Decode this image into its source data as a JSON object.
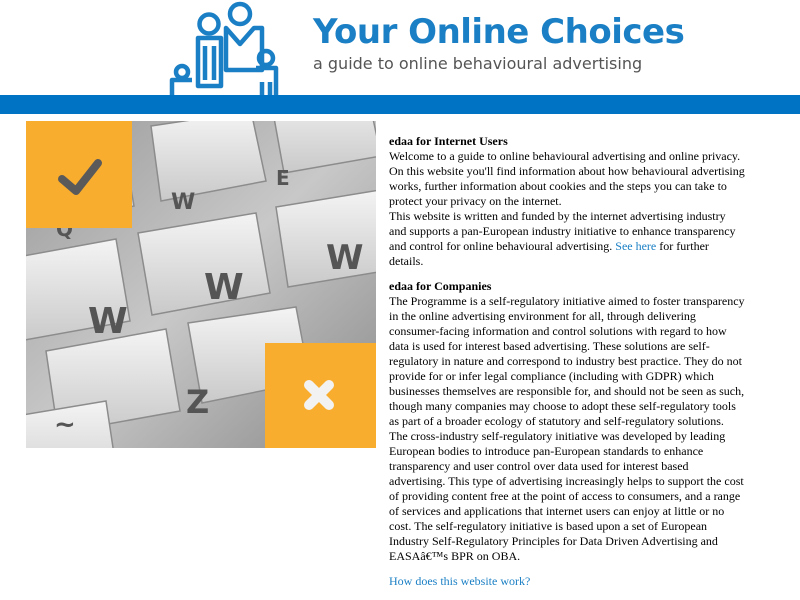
{
  "header": {
    "brand_title": "Your Online Choices",
    "brand_subtitle": "a guide to online behavioural advertising",
    "logo_icon": "family-icon"
  },
  "colors": {
    "brand_blue": "#1a7fc4",
    "bar_blue": "#0073c4",
    "accent_orange": "#f9ad2f",
    "link": "#1a7fc4"
  },
  "hero": {
    "tile_icons": [
      "checkmark-icon",
      "cross-icon"
    ],
    "key_letters": [
      "W",
      "E",
      "W",
      "W",
      "Q",
      "W",
      "W",
      "Z",
      "~"
    ]
  },
  "users": {
    "heading": "edaa for Internet Users",
    "para1": "Welcome to a guide to online behavioural advertising and online privacy. On this website you'll find information about how behavioural advertising works, further information about cookies and the steps you can take to protect your privacy on the internet.",
    "para2_text": "This website is written and funded by the internet advertising industry and supports a pan-European industry initiative to enhance transparency and control for online behavioural advertising.",
    "see_here_link": "See here",
    "para2_tail": "for further details."
  },
  "companies": {
    "heading": "edaa for Companies",
    "body": "The Programme is a self-regulatory initiative aimed to foster transparency in the online advertising environment for all, through delivering consumer-facing information and control solutions with regard to how data is used for interest based advertising. These solutions are self-regulatory in nature and correspond to industry best practice. They do not provide for or infer legal compliance (including with GDPR) which businesses themselves are responsible for, and should not be seen as such, though many companies may choose to adopt these self-regulatory tools as part of a broader ecology of statutory and self-regulatory solutions. The cross-industry self-regulatory initiative was developed by leading European bodies to introduce pan-European standards to enhance transparency and user control over data used for interest based advertising. This type of advertising increasingly helps to support the cost of providing content free at the point of access to consumers, and a range of services and applications that internet users can enjoy at little or no cost. The self-regulatory initiative is based upon a set of European Industry Self-Regulatory Principles for Data Driven Advertising and EASAâ€™s BPR on OBA."
  },
  "footer_link": "How does this website work?"
}
